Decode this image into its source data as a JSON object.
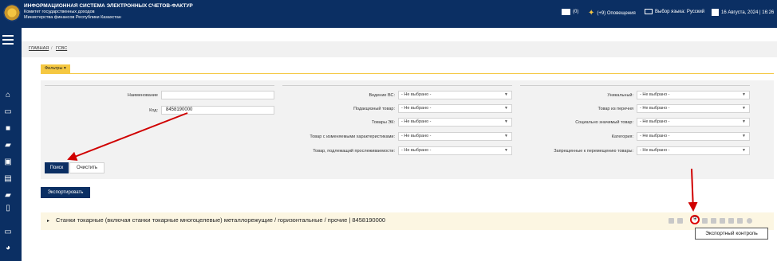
{
  "header": {
    "system_title": "ИНФОРМАЦИОННАЯ СИСТЕМА ЭЛЕКТРОННЫХ СЧЕТОВ-ФАКТУР",
    "subtitle_1": "Комитет государственных доходов",
    "subtitle_2": "Министерства финансов Республики Казахстан",
    "messages_count": "(0)",
    "notifications": "(+9) Оповещения",
    "language": "Выбор языка: Русский",
    "datetime": "16 Августа, 2024 | 16:26"
  },
  "breadcrumb": {
    "home": "ГЛАВНАЯ",
    "separator": "/",
    "current": "ГСВС"
  },
  "filters": {
    "tab_label": "Фильтры ▾",
    "name_label": "Наименование",
    "name_value": "",
    "code_label": "Код:",
    "code_value": "8458190000",
    "mid": [
      {
        "label": "Ведение ВС:",
        "value": "- Не выбрано -"
      },
      {
        "label": "Подакцизный товар:",
        "value": "- Не выбрано -"
      },
      {
        "label": "Товары ЭК:",
        "value": "- Не выбрано -"
      },
      {
        "label": "Товар с изменяемыми характеристиками:",
        "value": "- Не выбрано -"
      },
      {
        "label": "Товар, подлежащий прослеживаемости:",
        "value": "- Не выбрано -"
      }
    ],
    "right": [
      {
        "label": "Уникальный:",
        "value": "- Не выбрано -"
      },
      {
        "label": "Товар из перечня",
        "value": "- Не выбрано -"
      },
      {
        "label": "Социально значимый товар:",
        "value": "- Не выбрано -"
      },
      {
        "label": "Категория:",
        "value": "- Не выбрано -"
      },
      {
        "label": "Запрещенные к перемещению товары:",
        "value": "- Не выбрано -"
      }
    ],
    "search_button": "Поиск",
    "clear_button": "Очистить"
  },
  "export_button": "Экспортировать",
  "result": {
    "expand_icon": "▸",
    "text": "Станки токарные (включая станки токарные многоцелевые) металлорежущие / горизонтальные / прочие | 8458190000"
  },
  "tooltip": "Экспортный контроль",
  "icons": {
    "menu": "menu-icon",
    "home": "home-icon",
    "monitor": "monitor-icon",
    "briefcase": "briefcase-icon",
    "folder": "folder-icon",
    "image": "image-icon",
    "archive": "archive-icon",
    "document": "document-icon",
    "dashboard": "dashboard-icon",
    "shield": "shield-icon"
  },
  "colors": {
    "navy": "#0b2f63",
    "accent": "#f5c842",
    "annotation": "#d00000"
  }
}
